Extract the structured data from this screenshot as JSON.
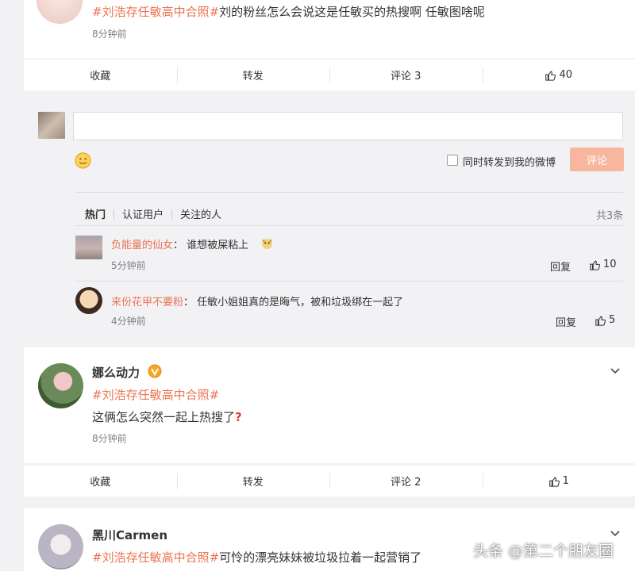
{
  "post1": {
    "topic": "#刘浩存任敏高中合照#",
    "text": "刘的粉丝怎么会说这是任敏买的热搜啊 任敏图啥呢",
    "time": "8分钟前",
    "actions": {
      "collect": "收藏",
      "repost": "转发",
      "comment": "评论 3",
      "like": "40"
    }
  },
  "comment_box": {
    "repost_label": "同时转发到我的微博",
    "submit": "评论",
    "tabs": [
      "热门",
      "认证用户",
      "关注的人"
    ],
    "total": "共3条"
  },
  "comments": [
    {
      "user": "负能量的仙女",
      "colon": "：",
      "text": "谁想被屎粘上",
      "time": "5分钟前",
      "reply": "回复",
      "likes": "10"
    },
    {
      "user": "来份花甲不要粉",
      "colon": "：",
      "text": "任敏小姐姐真的是晦气，被和垃圾绑在一起了",
      "time": "4分钟前",
      "reply": "回复",
      "likes": "5"
    }
  ],
  "post2": {
    "author": "娜么动力",
    "topic": "#刘浩存任敏高中合照#",
    "text": "这俩怎么突然一起上热搜了",
    "time": "8分钟前",
    "actions": {
      "collect": "收藏",
      "repost": "转发",
      "comment": "评论 2",
      "like": "1"
    }
  },
  "post3": {
    "author": "黑川Carmen",
    "topic": "#刘浩存任敏高中合照#",
    "text": "可怜的漂亮妹妹被垃圾拉着一起营销了"
  },
  "watermark": "头条 @第二个朋友圈",
  "colors": {
    "accent": "#eb7350",
    "button_disabled": "#f7b79f",
    "background": "#f2f2f5"
  }
}
